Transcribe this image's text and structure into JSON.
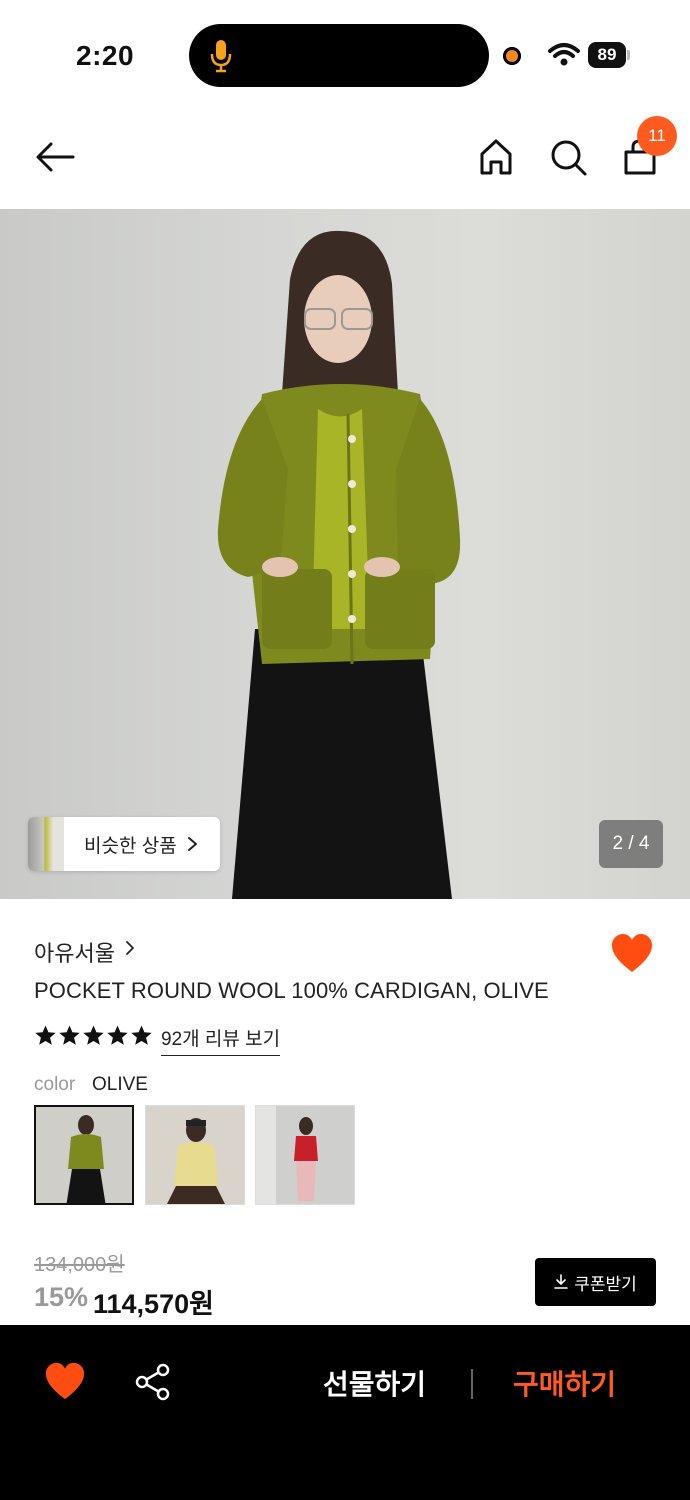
{
  "status_bar": {
    "time": "2:20",
    "battery": "89"
  },
  "nav": {
    "cart_count": "11"
  },
  "gallery": {
    "similar_label": "비슷한 상품",
    "counter": "2 / 4"
  },
  "product": {
    "brand": "아유서울",
    "title": "POCKET ROUND WOOL 100% CARDIGAN, OLIVE",
    "rating_stars": 5,
    "reviews_label": "92개 리뷰 보기",
    "color_label": "color",
    "color_value": "OLIVE",
    "original_price": "134,000원",
    "discount": "15%",
    "price": "114,570원",
    "coupon_label": "쿠폰받기"
  },
  "bottom_bar": {
    "gift_label": "선물하기",
    "buy_label": "구매하기"
  },
  "colors": {
    "accent": "#ff5a1f",
    "heart": "#ff4d12",
    "olive": "#7f8a1e"
  }
}
